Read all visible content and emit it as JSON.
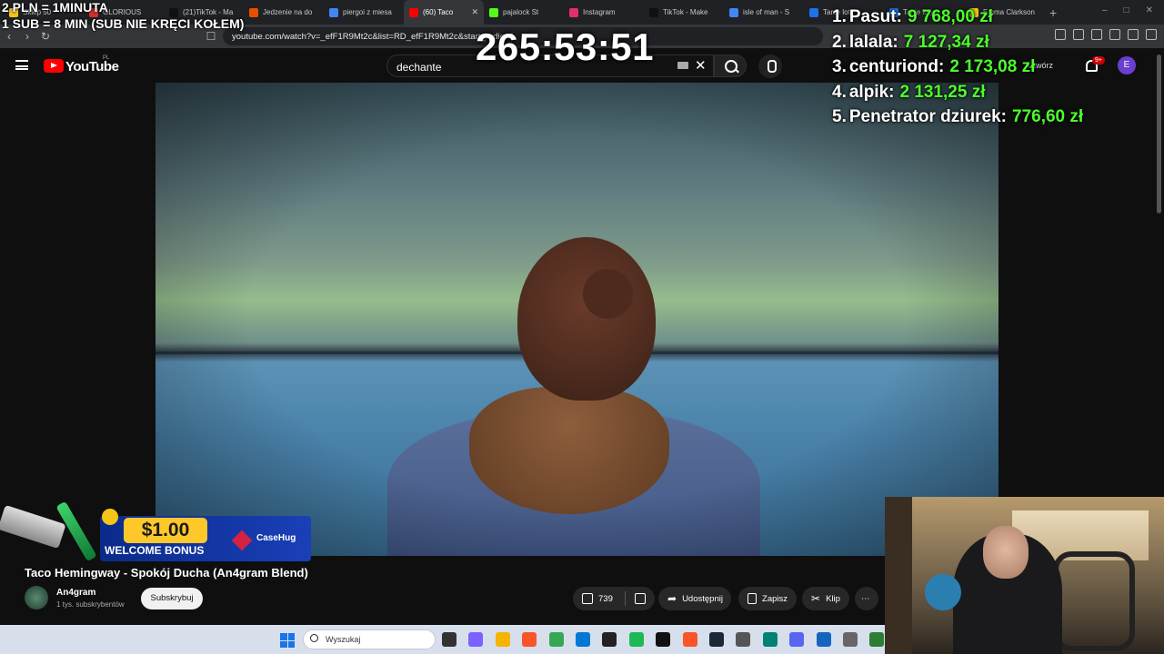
{
  "browser": {
    "tabs": [
      {
        "label": "Sklep 50",
        "color": "#f5c518"
      },
      {
        "label": "GLORIOUS",
        "color": "#d32f2f"
      },
      {
        "label": "(21)TikTok - Ma",
        "color": "#111111"
      },
      {
        "label": "Jedzenie na do",
        "color": "#e65100"
      },
      {
        "label": "piergoi z miesa",
        "color": "#4285f4"
      },
      {
        "label": "(60) Taco",
        "color": "#ff0000"
      },
      {
        "label": "pajalock St",
        "color": "#53fc18"
      },
      {
        "label": "Instagram",
        "color": "#e1306c"
      },
      {
        "label": "TikTok - Make",
        "color": "#111111"
      },
      {
        "label": "isle of man - S",
        "color": "#4285f4"
      },
      {
        "label": "Tanie loty",
        "color": "#1a73e8"
      },
      {
        "label": "Tanie loty",
        "color": "#1a73e8"
      },
      {
        "label": "Emma Clarkson",
        "color": "#f5c518"
      }
    ],
    "active_tab_index": 5,
    "url": "youtube.com/watch?v=_efF1R9Mt2c&list=RD_efF1R9Mt2c&start_radio=1"
  },
  "youtube": {
    "brand": "YouTube",
    "country": "PL",
    "search_value": "dechante",
    "create_label": "Utwórz",
    "notifications": "9+",
    "avatar_letter": "E",
    "video": {
      "title": "Taco Hemingway - Spokój Ducha (An4gram Blend)",
      "channel": "An4gram",
      "subscribers": "1 tys. subskrybentów",
      "subscribe_label": "Subskrybuj",
      "likes": "739",
      "share_label": "Udostępnij",
      "save_label": "Zapisz",
      "clip_label": "Klip"
    }
  },
  "stream_overlay": {
    "rate_line_1": "2 PLN = 1MINUTA",
    "rate_line_2": "1 SUB = 8 MIN (SUB NIE KRĘCI KOŁEM)",
    "timer": "265:53:51",
    "leaderboard": [
      {
        "rank": "1.",
        "name": "Pasut:",
        "amount": "9 768,00 zł"
      },
      {
        "rank": "2.",
        "name": "lalala:",
        "amount": "7 127,34 zł"
      },
      {
        "rank": "3.",
        "name": "centuriond:",
        "amount": "2 173,08 zł"
      },
      {
        "rank": "4.",
        "name": "alpik:",
        "amount": "2 131,25 zł"
      },
      {
        "rank": "5.",
        "name": "Penetrator dziurek:",
        "amount": "776,60 zł"
      }
    ],
    "promo": {
      "amount": "$1.00",
      "bonus": "WELCOME BONUS",
      "brand": "CaseHug"
    }
  },
  "taskbar": {
    "search_placeholder": "Wyszukaj",
    "apps": [
      {
        "name": "task-view",
        "color": "#333333"
      },
      {
        "name": "copilot",
        "color": "#7b61ff"
      },
      {
        "name": "explorer",
        "color": "#f4b400"
      },
      {
        "name": "brave",
        "color": "#fb542b"
      },
      {
        "name": "chrome",
        "color": "#34a853"
      },
      {
        "name": "store",
        "color": "#0078d4"
      },
      {
        "name": "app-dark",
        "color": "#222222"
      },
      {
        "name": "spotify",
        "color": "#1db954"
      },
      {
        "name": "moza",
        "color": "#111111"
      },
      {
        "name": "brave-2",
        "color": "#fb542b"
      },
      {
        "name": "steam",
        "color": "#1b2838"
      },
      {
        "name": "calculator",
        "color": "#555555"
      },
      {
        "name": "app-teal",
        "color": "#008272"
      },
      {
        "name": "discord",
        "color": "#5865f2"
      },
      {
        "name": "app-blue",
        "color": "#1565c0"
      },
      {
        "name": "settings",
        "color": "#666666"
      },
      {
        "name": "app-green",
        "color": "#2e7d32"
      },
      {
        "name": "app-cyan",
        "color": "#00acc1"
      }
    ]
  }
}
